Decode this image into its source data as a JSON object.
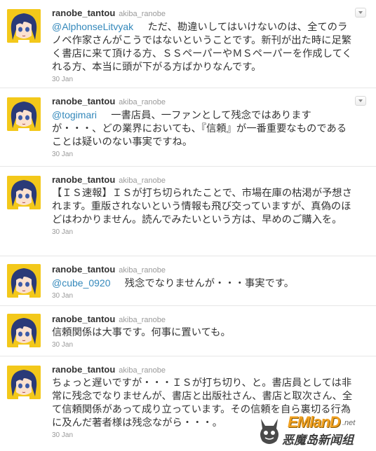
{
  "tweets": [
    {
      "username": "ranobe_tantou",
      "handle": "akiba_ranobe",
      "mention": "@AlphonseLitvyak",
      "text": "　ただ、勘違いしてはいけないのは、全てのラノベ作家さんがこうではないということです。新刊が出た時に足繁く書店に来て頂ける方、ＳＳペーパーやＭＳペーパーを作成してくれる方、本当に頭が下がる方ばかりなんです。",
      "date": "30 Jan"
    },
    {
      "username": "ranobe_tantou",
      "handle": "akiba_ranobe",
      "mention": "@togimari",
      "text": "　一書店員、一ファンとして残念ではありますが・・・、どの業界においても、『信頼』が一番重要なものであることは疑いのない事実ですね。",
      "date": "30 Jan"
    },
    {
      "username": "ranobe_tantou",
      "handle": "akiba_ranobe",
      "mention": "",
      "text": "【ＩＳ速報】ＩＳが打ち切られたことで、市場在庫の枯渇が予想されます。重版されないという情報も飛び交っていますが、真偽のほどはわかりません。読んでみたいという方は、早めのご購入を。",
      "date": "30 Jan"
    },
    {
      "username": "ranobe_tantou",
      "handle": "akiba_ranobe",
      "mention": "@cube_0920",
      "text": "　残念でなりませんが・・・事実です。",
      "date": "30 Jan"
    },
    {
      "username": "ranobe_tantou",
      "handle": "akiba_ranobe",
      "mention": "",
      "text": "信頼関係は大事です。何事に置いても。",
      "date": "30 Jan"
    },
    {
      "username": "ranobe_tantou",
      "handle": "akiba_ranobe",
      "mention": "",
      "text": "ちょっと遅いですが・・・ＩＳが打ち切り、と。書店員としては非常に残念でなりませんが、書店と出版社さん、書店と取次さん、全て信頼関係があって成り立っています。その信頼を自ら裏切る行為に及んだ著者様は残念ながら・・・。",
      "date": "30 Jan"
    }
  ],
  "watermark": {
    "logo": "EMlanD",
    "net": ".net",
    "subtitle": "恶魔岛新闻组"
  },
  "colors": {
    "mention": "#3388bb",
    "avatar_bg": "#f3c81a",
    "text": "#333333",
    "muted": "#999999"
  },
  "icons": {
    "avatar": "anime-girl-avatar",
    "menu": "chevron-down-icon"
  }
}
